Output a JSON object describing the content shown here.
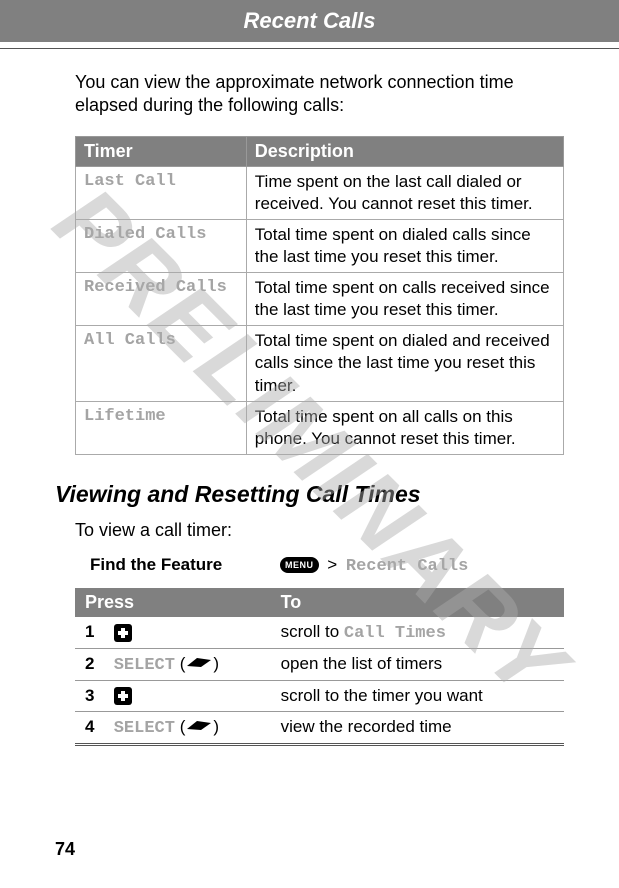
{
  "header": {
    "title": "Recent Calls"
  },
  "intro": "You can view the approximate network connection time elapsed during the following calls:",
  "table1": {
    "headers": {
      "timer": "Timer",
      "description": "Description"
    },
    "rows": [
      {
        "timer": "Last Call",
        "desc": "Time spent on the last call dialed or received. You cannot reset this timer."
      },
      {
        "timer": "Dialed Calls",
        "desc": "Total time spent on dialed calls since the last time you reset this timer."
      },
      {
        "timer": "Received Calls",
        "desc": "Total time spent on calls received since the last time you reset this timer."
      },
      {
        "timer": "All Calls",
        "desc": "Total time spent on dialed and received calls since the last time you reset this timer."
      },
      {
        "timer": "Lifetime",
        "desc": "Total time spent on all calls on this phone. You cannot reset this timer."
      }
    ]
  },
  "section_heading": "Viewing and Resetting Call Times",
  "sub_text": "To view a call timer:",
  "find_feature": {
    "label": "Find the Feature",
    "menu_key": "MENU",
    "gt": ">",
    "path": "Recent Calls"
  },
  "table2": {
    "headers": {
      "press": "Press",
      "to": "To"
    },
    "rows": [
      {
        "num": "1",
        "key_type": "dpad",
        "key_label": "",
        "to_pre": "scroll to ",
        "to_mono": "Call Times",
        "to_post": ""
      },
      {
        "num": "2",
        "key_type": "softkey",
        "key_label": "SELECT",
        "to_pre": "open the list of timers",
        "to_mono": "",
        "to_post": ""
      },
      {
        "num": "3",
        "key_type": "dpad",
        "key_label": "",
        "to_pre": "scroll to the timer you want",
        "to_mono": "",
        "to_post": ""
      },
      {
        "num": "4",
        "key_type": "softkey",
        "key_label": "SELECT",
        "to_pre": "view the recorded time",
        "to_mono": "",
        "to_post": ""
      }
    ]
  },
  "page_number": "74",
  "watermark": "PRELIMINARY"
}
